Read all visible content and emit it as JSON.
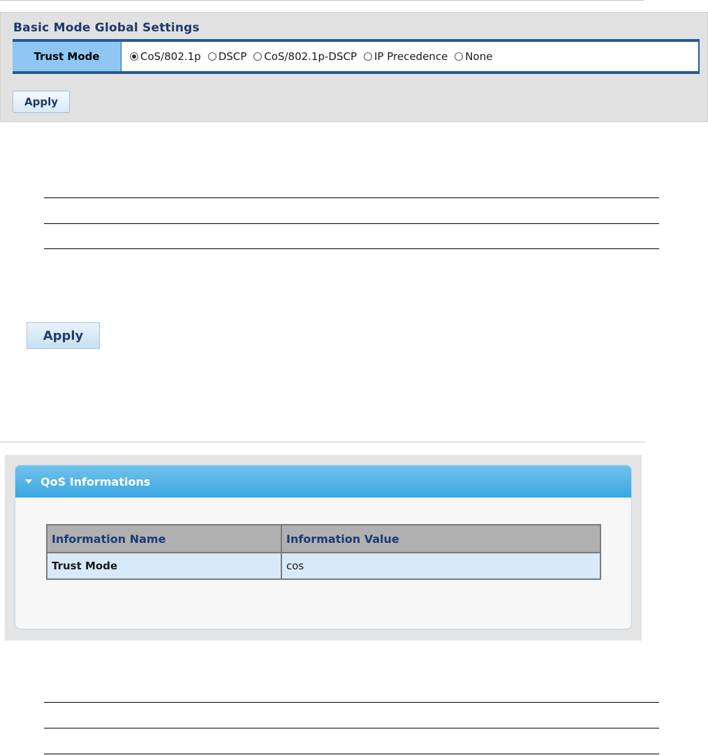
{
  "settings": {
    "title": "Basic Mode Global Settings",
    "trust_mode_label": "Trust Mode",
    "options": [
      {
        "label": "CoS/802.1p",
        "selected": true
      },
      {
        "label": "DSCP",
        "selected": false
      },
      {
        "label": "CoS/802.1p-DSCP",
        "selected": false
      },
      {
        "label": "IP Precedence",
        "selected": false
      },
      {
        "label": "None",
        "selected": false
      }
    ],
    "apply_label": "Apply"
  },
  "apply_large_label": "Apply",
  "qos": {
    "title": "QoS Informations",
    "columns": [
      "Information Name",
      "Information Value"
    ],
    "rows": [
      {
        "name": "Trust Mode",
        "value": "cos"
      }
    ]
  },
  "colors": {
    "panel_border_blue": "#265a96",
    "label_bg": "#8ec7f4",
    "header_blue": "#3aa6e2"
  }
}
